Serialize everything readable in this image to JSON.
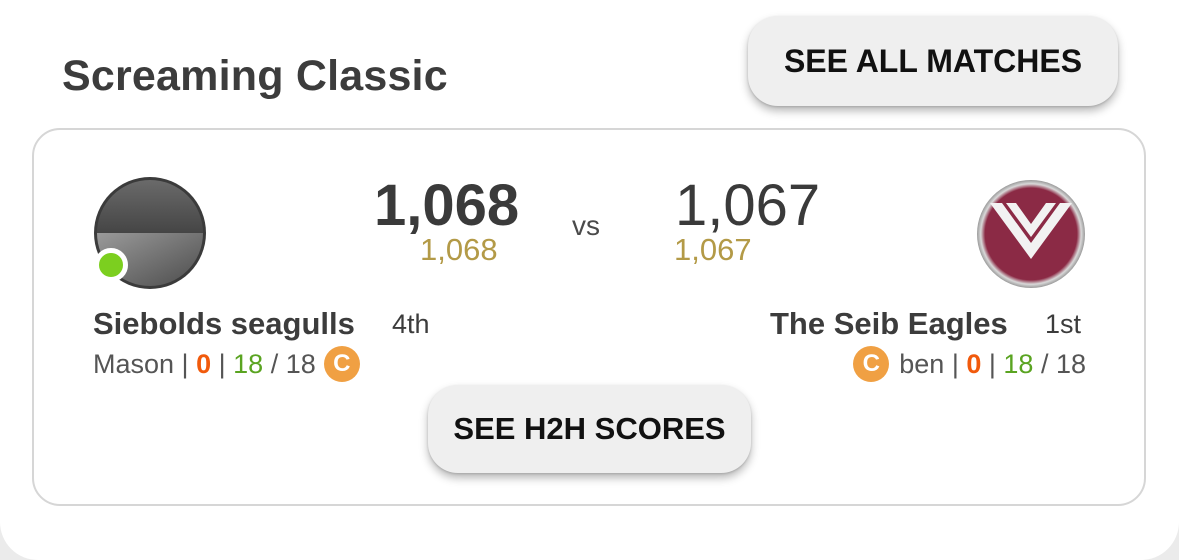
{
  "league": {
    "title": "Screaming Classic"
  },
  "buttons": {
    "see_all": "SEE ALL MATCHES",
    "see_h2h": "SEE H2H SCORES"
  },
  "match": {
    "vs_label": "vs",
    "home": {
      "team_name": "Siebolds seagulls",
      "rank": "4th",
      "score": "1,068",
      "projected": "1,068",
      "coach": "Mason",
      "sep1": " | ",
      "red_value": "0",
      "sep2": " | ",
      "green_value": "18",
      "total": " / 18",
      "captain_label": "C",
      "online": true
    },
    "away": {
      "team_name": "The Seib Eagles",
      "rank": "1st",
      "score": "1,067",
      "projected": "1,067",
      "coach": "ben",
      "sep1": " | ",
      "red_value": "0",
      "sep2": " | ",
      "green_value": "18",
      "total": " / 18",
      "captain_label": "C"
    }
  },
  "colors": {
    "projected": "#b39a47",
    "red_value": "#f15a0c",
    "green_value": "#5aa421",
    "captain_badge": "#f0a043",
    "online_dot": "#7ccf1f",
    "away_logo": "#8b2a45"
  },
  "icons": {
    "home_avatar": "grey-circle-team-logo",
    "away_avatar": "maroon-chevron-team-logo",
    "online": "online-status-dot"
  }
}
